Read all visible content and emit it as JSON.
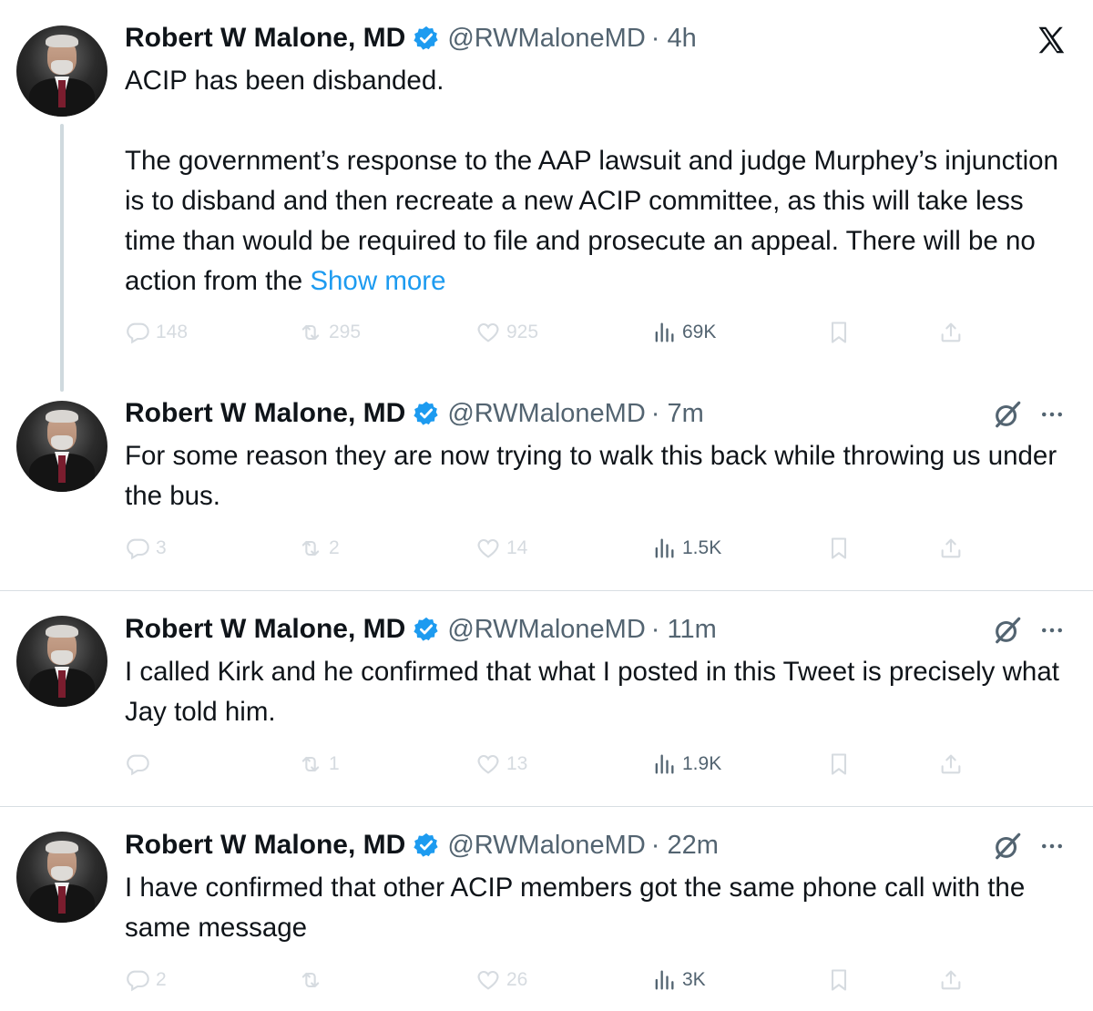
{
  "author": {
    "name": "Robert W Malone, MD",
    "handle": "@RWMaloneMD"
  },
  "colors": {
    "link": "#1d9bf0",
    "verified": "#1d9bf0",
    "secondary_text": "#536471",
    "faded_icons": "#d6dbe0"
  },
  "tweets": [
    {
      "time": "· 4h",
      "paragraphs": [
        "ACIP has been disbanded.",
        "The government’s response to the AAP lawsuit and judge Murphey’s injunction is to disband and then recreate a new ACIP committee, as this will take less time than would be required to file and prosecute an appeal.  There will be no action from the"
      ],
      "show_more": "Show more",
      "replies": "148",
      "reposts": "295",
      "likes": "925",
      "views": "69K"
    },
    {
      "time": "· 7m",
      "text": "For some reason they are now trying to walk this back while throwing us under the bus.",
      "replies": "3",
      "reposts": "2",
      "likes": "14",
      "views": "1.5K"
    },
    {
      "time": "· 11m",
      "text": "I called Kirk and he confirmed that what I posted in this Tweet is precisely what Jay told him.",
      "replies": "",
      "reposts": "1",
      "likes": "13",
      "views": "1.9K"
    },
    {
      "time": "· 22m",
      "text": "I have confirmed that other ACIP members got the same phone call with the same message",
      "replies": "2",
      "reposts": "",
      "likes": "26",
      "views": "3K"
    }
  ],
  "icons": [
    "x-logo-icon",
    "verified-badge-icon",
    "reply-icon",
    "repost-icon",
    "like-icon",
    "views-icon",
    "bookmark-icon",
    "share-icon",
    "grok-icon",
    "more-icon"
  ]
}
